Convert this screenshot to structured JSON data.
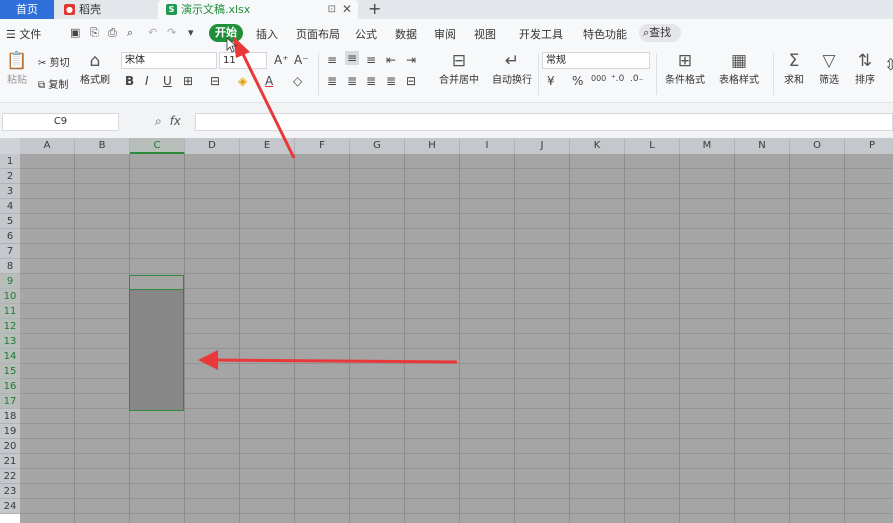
{
  "titlebar": {
    "home_tab": "首页",
    "tab_shell": "稻壳",
    "tab_file": "演示文稿.xlsx",
    "add_tab": "+",
    "close": "✕",
    "pin": "⊡"
  },
  "menubar": {
    "file_menu": "☰ 文件",
    "items": [
      "开始",
      "插入",
      "页面布局",
      "公式",
      "数据",
      "审阅",
      "视图",
      "开发工具",
      "特色功能"
    ],
    "search": "查找"
  },
  "ribbon": {
    "paste": "粘贴",
    "cut": "剪切",
    "copy": "复制",
    "format_painter": "格式刷",
    "font_name": "宋体",
    "font_size": "11",
    "merge_center": "合并居中",
    "auto_wrap": "自动换行",
    "number_format": "常规",
    "conditional_format": "条件格式",
    "table_style": "表格样式",
    "sum": "求和",
    "filter": "筛选",
    "sort": "排序",
    "percent": "%",
    "thousands": "000"
  },
  "formula_bar": {
    "name_box": "C9",
    "fx": "fx",
    "formula": ""
  },
  "grid": {
    "columns": [
      "A",
      "B",
      "C",
      "D",
      "E",
      "F",
      "G",
      "H",
      "I",
      "J",
      "K",
      "L",
      "M",
      "N",
      "O",
      "P"
    ],
    "selected_column": "C",
    "rows": [
      "1",
      "2",
      "3",
      "4",
      "5",
      "6",
      "7",
      "8",
      "9",
      "10",
      "11",
      "12",
      "13",
      "14",
      "15",
      "16",
      "17",
      "18",
      "19",
      "20",
      "21",
      "22",
      "23",
      "24"
    ],
    "selected_rows": [
      "9",
      "10",
      "11",
      "12",
      "13",
      "14",
      "15",
      "16",
      "17"
    ]
  },
  "colors": {
    "accent_green": "#1f8f3a",
    "home_blue": "#2f6fda",
    "arrow_red": "#e8383a",
    "sheet_overlay": "#a5a5a5"
  }
}
